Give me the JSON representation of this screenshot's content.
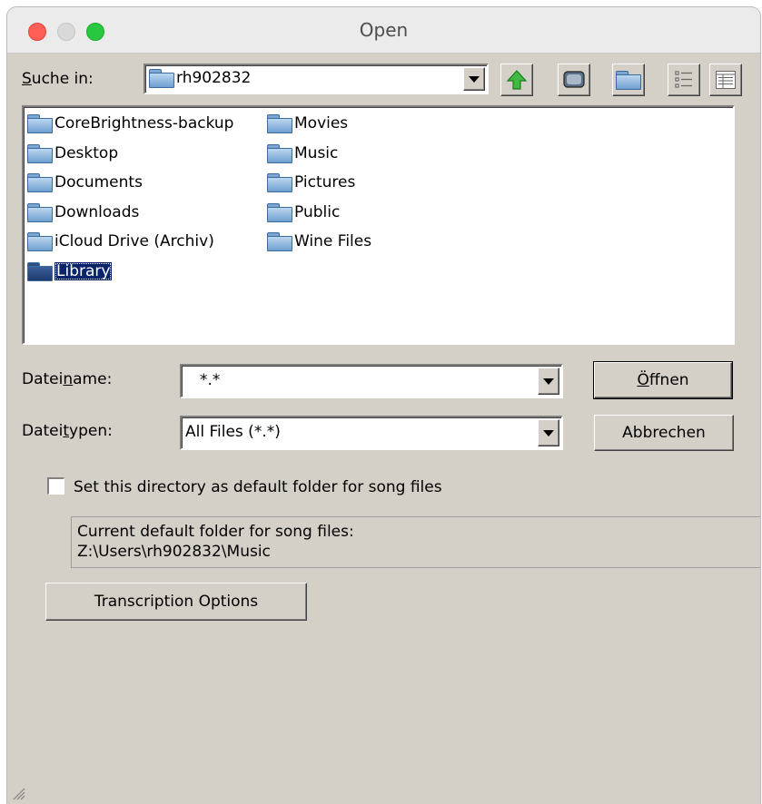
{
  "window": {
    "title": "Open"
  },
  "look_in": {
    "label_prefix": "",
    "label_accel": "S",
    "label_rest": "uche in:",
    "value": "rh902832"
  },
  "toolbar": {
    "up_icon": "up-folder-icon",
    "desktop_icon": "desktop-icon",
    "new_folder_icon": "new-folder-icon",
    "list_view_icon": "list-view-icon",
    "details_view_icon": "details-view-icon"
  },
  "files": {
    "column1": [
      {
        "name": "CoreBrightness-backup"
      },
      {
        "name": "Desktop"
      },
      {
        "name": "Documents"
      },
      {
        "name": "Downloads"
      },
      {
        "name": "iCloud Drive (Archiv)"
      },
      {
        "name": "Library",
        "selected": true
      }
    ],
    "column2": [
      {
        "name": "Movies"
      },
      {
        "name": "Music"
      },
      {
        "name": "Pictures"
      },
      {
        "name": "Public"
      },
      {
        "name": "Wine Files"
      }
    ]
  },
  "filename": {
    "label_pre": "Datei",
    "label_accel": "n",
    "label_post": "ame:",
    "value": "*.*"
  },
  "filetype": {
    "label_pre": "Datei",
    "label_accel": "t",
    "label_post": "ypen:",
    "value": "All Files (*.*)"
  },
  "buttons": {
    "open_accel": "Ö",
    "open_rest": "ffnen",
    "cancel": "Abbrechen",
    "transcription": "Transcription Options"
  },
  "default_folder": {
    "checkbox_label": "Set this directory as default folder for song files",
    "checked": false,
    "info_line1": "Current default folder for song files:",
    "info_line2": "Z:\\Users\\rh902832\\Music"
  }
}
